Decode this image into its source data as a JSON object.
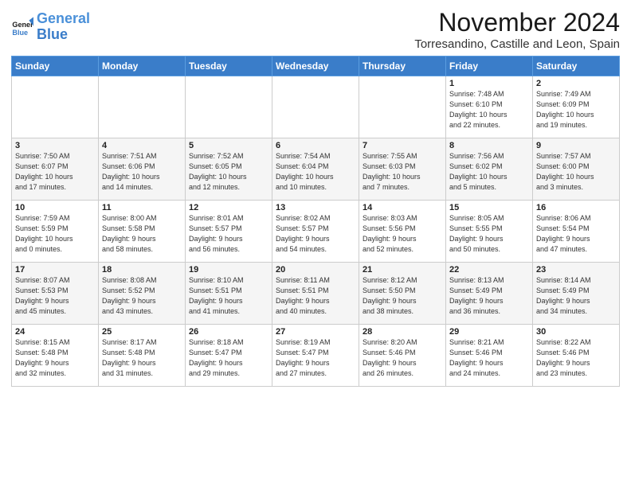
{
  "logo": {
    "line1": "General",
    "line2": "Blue"
  },
  "title": "November 2024",
  "location": "Torresandino, Castille and Leon, Spain",
  "weekdays": [
    "Sunday",
    "Monday",
    "Tuesday",
    "Wednesday",
    "Thursday",
    "Friday",
    "Saturday"
  ],
  "weeks": [
    [
      {
        "day": "",
        "info": ""
      },
      {
        "day": "",
        "info": ""
      },
      {
        "day": "",
        "info": ""
      },
      {
        "day": "",
        "info": ""
      },
      {
        "day": "",
        "info": ""
      },
      {
        "day": "1",
        "info": "Sunrise: 7:48 AM\nSunset: 6:10 PM\nDaylight: 10 hours\nand 22 minutes."
      },
      {
        "day": "2",
        "info": "Sunrise: 7:49 AM\nSunset: 6:09 PM\nDaylight: 10 hours\nand 19 minutes."
      }
    ],
    [
      {
        "day": "3",
        "info": "Sunrise: 7:50 AM\nSunset: 6:07 PM\nDaylight: 10 hours\nand 17 minutes."
      },
      {
        "day": "4",
        "info": "Sunrise: 7:51 AM\nSunset: 6:06 PM\nDaylight: 10 hours\nand 14 minutes."
      },
      {
        "day": "5",
        "info": "Sunrise: 7:52 AM\nSunset: 6:05 PM\nDaylight: 10 hours\nand 12 minutes."
      },
      {
        "day": "6",
        "info": "Sunrise: 7:54 AM\nSunset: 6:04 PM\nDaylight: 10 hours\nand 10 minutes."
      },
      {
        "day": "7",
        "info": "Sunrise: 7:55 AM\nSunset: 6:03 PM\nDaylight: 10 hours\nand 7 minutes."
      },
      {
        "day": "8",
        "info": "Sunrise: 7:56 AM\nSunset: 6:02 PM\nDaylight: 10 hours\nand 5 minutes."
      },
      {
        "day": "9",
        "info": "Sunrise: 7:57 AM\nSunset: 6:00 PM\nDaylight: 10 hours\nand 3 minutes."
      }
    ],
    [
      {
        "day": "10",
        "info": "Sunrise: 7:59 AM\nSunset: 5:59 PM\nDaylight: 10 hours\nand 0 minutes."
      },
      {
        "day": "11",
        "info": "Sunrise: 8:00 AM\nSunset: 5:58 PM\nDaylight: 9 hours\nand 58 minutes."
      },
      {
        "day": "12",
        "info": "Sunrise: 8:01 AM\nSunset: 5:57 PM\nDaylight: 9 hours\nand 56 minutes."
      },
      {
        "day": "13",
        "info": "Sunrise: 8:02 AM\nSunset: 5:57 PM\nDaylight: 9 hours\nand 54 minutes."
      },
      {
        "day": "14",
        "info": "Sunrise: 8:03 AM\nSunset: 5:56 PM\nDaylight: 9 hours\nand 52 minutes."
      },
      {
        "day": "15",
        "info": "Sunrise: 8:05 AM\nSunset: 5:55 PM\nDaylight: 9 hours\nand 50 minutes."
      },
      {
        "day": "16",
        "info": "Sunrise: 8:06 AM\nSunset: 5:54 PM\nDaylight: 9 hours\nand 47 minutes."
      }
    ],
    [
      {
        "day": "17",
        "info": "Sunrise: 8:07 AM\nSunset: 5:53 PM\nDaylight: 9 hours\nand 45 minutes."
      },
      {
        "day": "18",
        "info": "Sunrise: 8:08 AM\nSunset: 5:52 PM\nDaylight: 9 hours\nand 43 minutes."
      },
      {
        "day": "19",
        "info": "Sunrise: 8:10 AM\nSunset: 5:51 PM\nDaylight: 9 hours\nand 41 minutes."
      },
      {
        "day": "20",
        "info": "Sunrise: 8:11 AM\nSunset: 5:51 PM\nDaylight: 9 hours\nand 40 minutes."
      },
      {
        "day": "21",
        "info": "Sunrise: 8:12 AM\nSunset: 5:50 PM\nDaylight: 9 hours\nand 38 minutes."
      },
      {
        "day": "22",
        "info": "Sunrise: 8:13 AM\nSunset: 5:49 PM\nDaylight: 9 hours\nand 36 minutes."
      },
      {
        "day": "23",
        "info": "Sunrise: 8:14 AM\nSunset: 5:49 PM\nDaylight: 9 hours\nand 34 minutes."
      }
    ],
    [
      {
        "day": "24",
        "info": "Sunrise: 8:15 AM\nSunset: 5:48 PM\nDaylight: 9 hours\nand 32 minutes."
      },
      {
        "day": "25",
        "info": "Sunrise: 8:17 AM\nSunset: 5:48 PM\nDaylight: 9 hours\nand 31 minutes."
      },
      {
        "day": "26",
        "info": "Sunrise: 8:18 AM\nSunset: 5:47 PM\nDaylight: 9 hours\nand 29 minutes."
      },
      {
        "day": "27",
        "info": "Sunrise: 8:19 AM\nSunset: 5:47 PM\nDaylight: 9 hours\nand 27 minutes."
      },
      {
        "day": "28",
        "info": "Sunrise: 8:20 AM\nSunset: 5:46 PM\nDaylight: 9 hours\nand 26 minutes."
      },
      {
        "day": "29",
        "info": "Sunrise: 8:21 AM\nSunset: 5:46 PM\nDaylight: 9 hours\nand 24 minutes."
      },
      {
        "day": "30",
        "info": "Sunrise: 8:22 AM\nSunset: 5:46 PM\nDaylight: 9 hours\nand 23 minutes."
      }
    ]
  ]
}
